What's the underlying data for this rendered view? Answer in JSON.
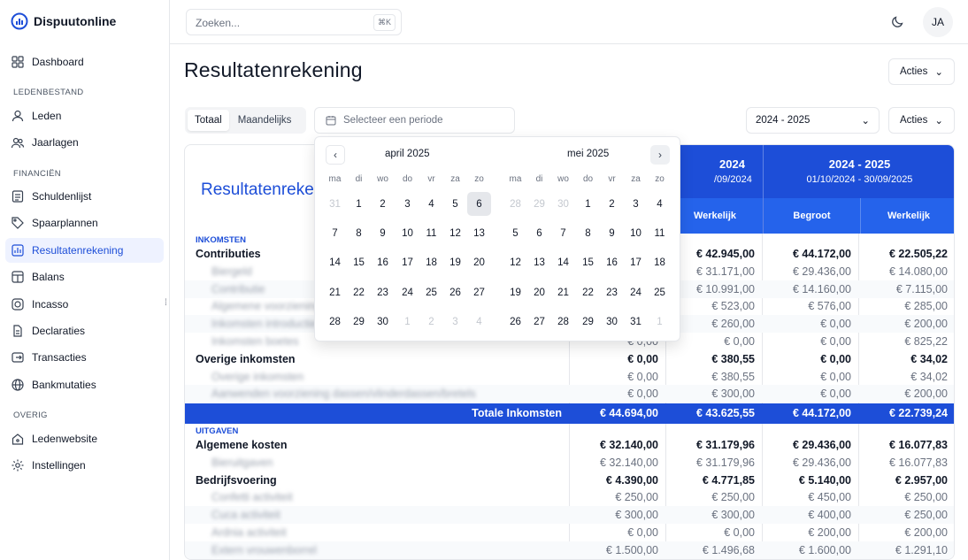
{
  "app": {
    "name": "Dispuutonline"
  },
  "sidebar": {
    "items": [
      {
        "label": "Dashboard",
        "icon": "grid-icon"
      },
      {
        "label": "Leden",
        "icon": "user-icon"
      },
      {
        "label": "Jaarlagen",
        "icon": "users-icon"
      },
      {
        "label": "Schuldenlijst",
        "icon": "list-icon"
      },
      {
        "label": "Spaarplannen",
        "icon": "tag-icon"
      },
      {
        "label": "Resultatenrekening",
        "icon": "chart-icon"
      },
      {
        "label": "Balans",
        "icon": "table-icon"
      },
      {
        "label": "Incasso",
        "icon": "incasso-icon"
      },
      {
        "label": "Declaraties",
        "icon": "file-icon"
      },
      {
        "label": "Transacties",
        "icon": "transfer-icon"
      },
      {
        "label": "Bankmutaties",
        "icon": "globe-icon"
      },
      {
        "label": "Ledenwebsite",
        "icon": "home-icon"
      },
      {
        "label": "Instellingen",
        "icon": "gear-icon"
      }
    ],
    "sections": [
      "LEDENBESTAND",
      "FINANCIËN",
      "OVERIG"
    ],
    "active": "Resultatenrekening"
  },
  "topbar": {
    "search_placeholder": "Zoeken...",
    "shortcut": "⌘K",
    "avatar": "JA"
  },
  "page": {
    "title": "Resultatenrekening",
    "actions": "Acties",
    "tabs": [
      "Totaal",
      "Maandelijks"
    ],
    "period_placeholder": "Selecteer een periode",
    "year_select": "2024 - 2025",
    "actions2": "Acties"
  },
  "calendar": {
    "months": [
      "april 2025",
      "mei 2025"
    ],
    "weekdays": [
      "ma",
      "di",
      "wo",
      "do",
      "vr",
      "za",
      "zo"
    ],
    "april": [
      [
        "31",
        "1",
        "2",
        "3",
        "4",
        "5",
        "6"
      ],
      [
        "7",
        "8",
        "9",
        "10",
        "11",
        "12",
        "13"
      ],
      [
        "14",
        "15",
        "16",
        "17",
        "18",
        "19",
        "20"
      ],
      [
        "21",
        "22",
        "23",
        "24",
        "25",
        "26",
        "27"
      ],
      [
        "28",
        "29",
        "30",
        "1",
        "2",
        "3",
        "4"
      ]
    ],
    "mei": [
      [
        "28",
        "29",
        "30",
        "1",
        "2",
        "3",
        "4"
      ],
      [
        "5",
        "6",
        "7",
        "8",
        "9",
        "10",
        "11"
      ],
      [
        "12",
        "13",
        "14",
        "15",
        "16",
        "17",
        "18"
      ],
      [
        "19",
        "20",
        "21",
        "22",
        "23",
        "24",
        "25"
      ],
      [
        "26",
        "27",
        "28",
        "29",
        "30",
        "31",
        "1"
      ]
    ],
    "selected": "6"
  },
  "report": {
    "card_title": "Resultatenreke",
    "columns": [
      {
        "year": "2024",
        "range": "/09/2024",
        "sub": [
          "Werkelijk"
        ]
      },
      {
        "year": "2024 - 2025",
        "range": "01/10/2024 - 30/09/2025",
        "sub": [
          "Begroot",
          "Werkelijk"
        ]
      }
    ],
    "income_label": "INKOMSTEN",
    "expense_label": "UITGAVEN",
    "rows": [
      {
        "type": "head",
        "label": "Contributies",
        "vals": [
          "",
          "€ 42.945,00",
          "€ 44.172,00",
          "€ 22.505,22"
        ]
      },
      {
        "type": "child",
        "label": "Biergeld",
        "vals": [
          "",
          "€ 31.171,00",
          "€ 29.436,00",
          "€ 14.080,00"
        ]
      },
      {
        "type": "child",
        "label": "Contributie",
        "vals": [
          "",
          "€ 10.991,00",
          "€ 14.160,00",
          "€ 7.115,00"
        ]
      },
      {
        "type": "child",
        "label": "Algemene voorziening",
        "vals": [
          "",
          "€ 523,00",
          "€ 576,00",
          "€ 285,00"
        ]
      },
      {
        "type": "child",
        "label": "Inkomsten introductie",
        "vals": [
          "",
          "€ 260,00",
          "€ 0,00",
          "€ 200,00"
        ]
      },
      {
        "type": "child",
        "label": "Inkomsten boetes",
        "vals": [
          "€ 0,00",
          "€ 0,00",
          "€ 0,00",
          "€ 825,22"
        ]
      },
      {
        "type": "head",
        "label": "Overige inkomsten",
        "vals": [
          "€ 0,00",
          "€ 380,55",
          "€ 0,00",
          "€ 34,02"
        ]
      },
      {
        "type": "child",
        "label": "Overige inkomsten",
        "vals": [
          "€ 0,00",
          "€ 380,55",
          "€ 0,00",
          "€ 34,02"
        ]
      },
      {
        "type": "child",
        "label": "Aanwenden voorziening dassen/vlinderdassen/bretels",
        "vals": [
          "€ 0,00",
          "€ 300,00",
          "€ 0,00",
          "€ 200,00"
        ]
      }
    ],
    "total_income": {
      "label": "Totale Inkomsten",
      "vals": [
        "€ 44.694,00",
        "€ 43.625,55",
        "€ 44.172,00",
        "€ 22.739,24"
      ]
    },
    "expense_rows": [
      {
        "type": "head",
        "label": "Algemene kosten",
        "vals": [
          "€ 32.140,00",
          "€ 31.179,96",
          "€ 29.436,00",
          "€ 16.077,83"
        ]
      },
      {
        "type": "child",
        "label": "Bieruitgaven",
        "vals": [
          "€ 32.140,00",
          "€ 31.179,96",
          "€ 29.436,00",
          "€ 16.077,83"
        ]
      },
      {
        "type": "head",
        "label": "Bedrijfsvoering",
        "vals": [
          "€ 4.390,00",
          "€ 4.771,85",
          "€ 5.140,00",
          "€ 2.957,00"
        ]
      },
      {
        "type": "child",
        "label": "Confetti activiteit",
        "vals": [
          "€ 250,00",
          "€ 250,00",
          "€ 450,00",
          "€ 250,00"
        ]
      },
      {
        "type": "child",
        "label": "Cuca activiteit",
        "vals": [
          "€ 300,00",
          "€ 300,00",
          "€ 400,00",
          "€ 250,00"
        ]
      },
      {
        "type": "child",
        "label": "Ardnia activiteit",
        "vals": [
          "€ 0,00",
          "€ 0,00",
          "€ 200,00",
          "€ 200,00"
        ]
      },
      {
        "type": "child",
        "label": "Extern vrouwenborrel",
        "vals": [
          "€ 1.500,00",
          "€ 1.496,68",
          "€ 1.600,00",
          "€ 1.291,10"
        ]
      }
    ]
  }
}
